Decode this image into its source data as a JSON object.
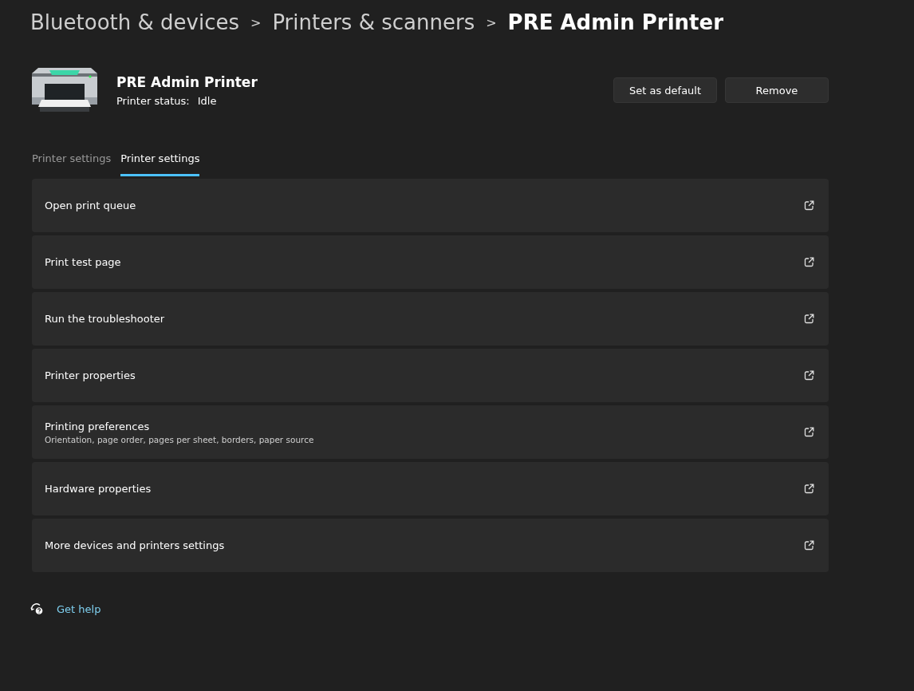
{
  "breadcrumb": [
    "Bluetooth & devices",
    "Printers & scanners",
    "PRE Admin Printer"
  ],
  "breadcrumb_separator": ">",
  "printer": {
    "name": "PRE Admin Printer",
    "status_label": "Printer status:",
    "status": "Idle"
  },
  "buttons": [
    "Set as default",
    "Remove"
  ],
  "tabs": [
    {
      "label": "Printer settings",
      "selected": false
    },
    {
      "label": "Printer settings",
      "selected": true
    }
  ],
  "rows": [
    {
      "title": "Open print queue"
    },
    {
      "title": "Print test page"
    },
    {
      "title": "Run the troubleshooter"
    },
    {
      "title": "Printer properties"
    },
    {
      "title": "Printing preferences",
      "subtitle": "Orientation, page order, pages per sheet, borders, paper source"
    },
    {
      "title": "Hardware properties"
    },
    {
      "title": "More devices and printers settings"
    }
  ],
  "help": {
    "label": "Get help"
  }
}
